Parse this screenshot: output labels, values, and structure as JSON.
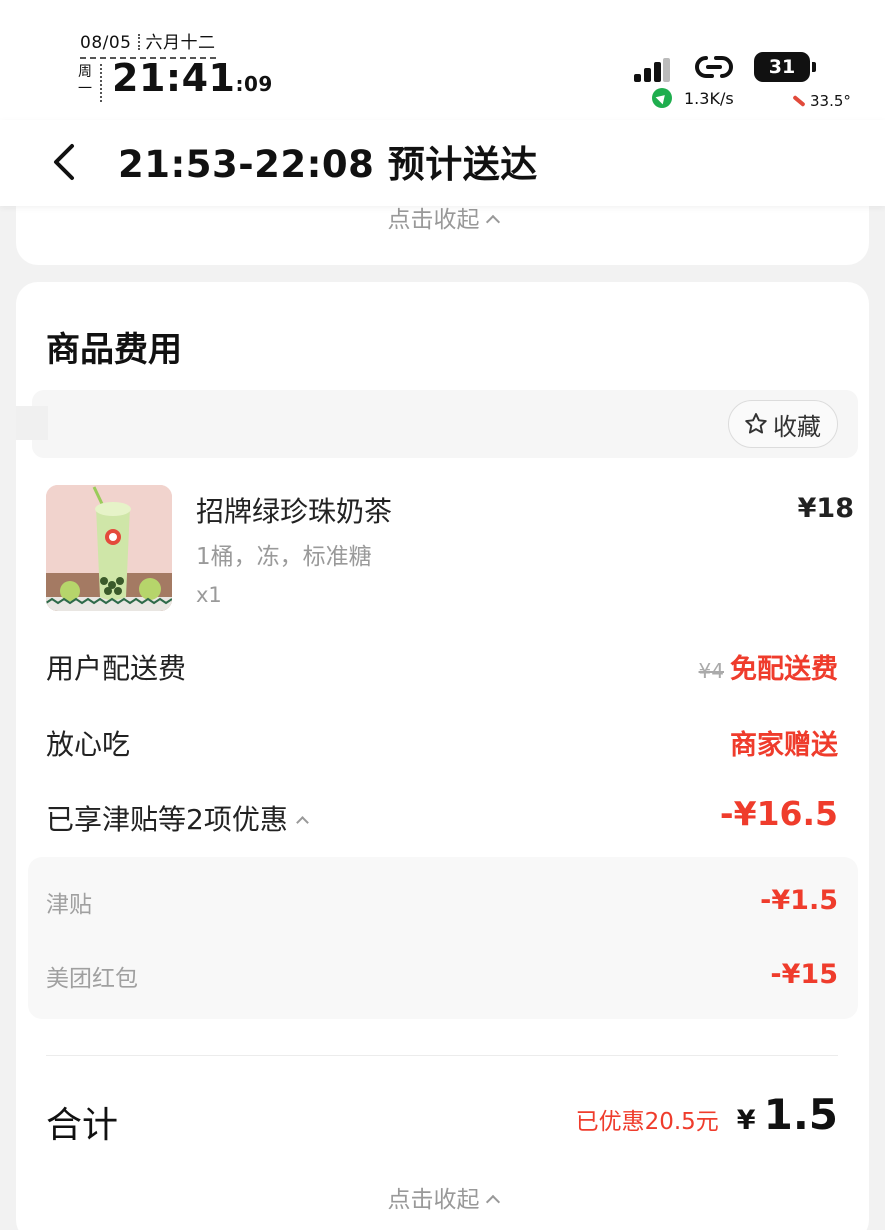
{
  "status_bar": {
    "date": "08/05",
    "lunar": "六月十二",
    "weekday": "周一",
    "time": "21:41",
    "seconds": ":09",
    "battery": "31",
    "net_speed": "1.3K/s",
    "temperature": "33.5°"
  },
  "header": {
    "title": "21:53-22:08 预计送达"
  },
  "top_card": {
    "collapse_label": "点击收起"
  },
  "fees": {
    "section_title": "商品费用",
    "favorite_label": "收藏",
    "product": {
      "name": "招牌绿珍珠奶茶",
      "spec": "1桶，冻，标准糖",
      "quantity": "x1",
      "price": "¥18"
    },
    "delivery_fee": {
      "label": "用户配送费",
      "original": "¥4",
      "value": "免配送费"
    },
    "safe_eat": {
      "label": "放心吃",
      "value": "商家赠送"
    },
    "discount_summary": {
      "label": "已享津贴等2项优惠",
      "value": "-¥16.5"
    },
    "discounts": [
      {
        "label": "津贴",
        "value": "-¥1.5"
      },
      {
        "label": "美团红包",
        "value": "-¥15"
      }
    ],
    "total": {
      "label": "合计",
      "saved": "已优惠20.5元",
      "currency": "¥",
      "amount": "1.5"
    },
    "collapse_label": "点击收起"
  },
  "colors": {
    "accent_red": "#ef3c2c",
    "page_bg": "#f2f2f2",
    "card_bg": "#ffffff"
  }
}
